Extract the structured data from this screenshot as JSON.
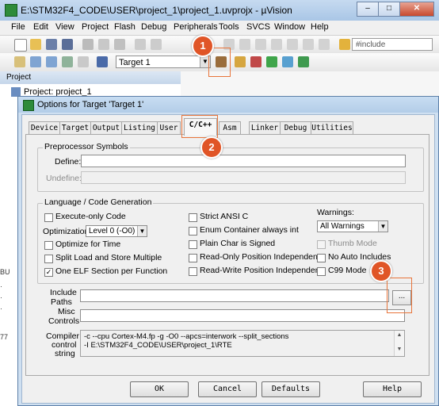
{
  "window": {
    "title": "E:\\STM32F4_CODE\\USER\\project_1\\project_1.uvprojx - µVision",
    "min": "–",
    "max": "□",
    "close": "✕"
  },
  "menu": [
    "File",
    "Edit",
    "View",
    "Project",
    "Flash",
    "Debug",
    "Peripherals",
    "Tools",
    "SVCS",
    "Window",
    "Help"
  ],
  "toolbar": {
    "target": "Target 1",
    "search": "#include"
  },
  "project_pane": {
    "header": "Project",
    "item": "Project: project_1",
    "strip": [
      "BU",
      "·",
      "·",
      "·",
      "77"
    ]
  },
  "dialog": {
    "title": "Options for Target 'Target 1'",
    "tabs": [
      "Device",
      "Target",
      "Output",
      "Listing",
      "User",
      "C/C++",
      "Asm",
      "Linker",
      "Debug",
      "Utilities"
    ],
    "active_tab": "C/C++",
    "preprocessor": {
      "legend": "Preprocessor Symbols",
      "define_label": "Define:",
      "define_value": "",
      "undefine_label": "Undefine:",
      "undefine_value": ""
    },
    "codegen": {
      "legend": "Language / Code Generation",
      "execute_only": "Execute-only Code",
      "optimization_label": "Optimization:",
      "optimization_value": "Level 0 (-O0)",
      "optimize_time": "Optimize for Time",
      "split_load": "Split Load and Store Multiple",
      "one_elf": "One ELF Section per Function",
      "strict_ansi": "Strict ANSI C",
      "enum_int": "Enum Container always int",
      "plain_char": "Plain Char is Signed",
      "ro_pi": "Read-Only Position Independent",
      "rw_pi": "Read-Write Position Independent",
      "warnings_label": "Warnings:",
      "warnings_value": "All Warnings",
      "thumb_mode": "Thumb Mode",
      "no_auto_includes": "No Auto Includes",
      "c99": "C99 Mode"
    },
    "include_label_1": "Include",
    "include_label_2": "Paths",
    "include_value": "",
    "browse": "...",
    "misc_label_1": "Misc",
    "misc_label_2": "Controls",
    "misc_value": "",
    "compiler_label_1": "Compiler",
    "compiler_label_2": "control",
    "compiler_label_3": "string",
    "compiler_line_1": "-c --cpu Cortex-M4.fp -g -O0 --apcs=interwork --split_sections",
    "compiler_line_2": "-I E:\\STM32F4_CODE\\USER\\project_1\\RTE",
    "buttons": {
      "ok": "OK",
      "cancel": "Cancel",
      "defaults": "Defaults",
      "help": "Help"
    }
  },
  "annotations": [
    "1",
    "2",
    "3"
  ],
  "colors": {
    "badge": "#e05527",
    "highlight": "#e8743a",
    "title_gradient_top": "#c6daf0"
  }
}
